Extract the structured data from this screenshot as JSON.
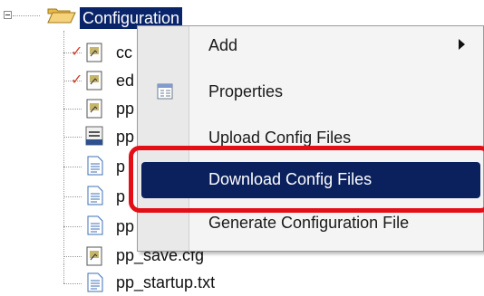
{
  "tree": {
    "root_folder": "Configuration",
    "children": [
      {
        "label": "cc"
      },
      {
        "label": "ed"
      },
      {
        "label": "pp"
      },
      {
        "label": "pp"
      },
      {
        "label": "p"
      },
      {
        "label": "p"
      },
      {
        "label": "pp"
      },
      {
        "label": "pp_save.cfg"
      },
      {
        "label": "pp_startup.txt"
      }
    ]
  },
  "context_menu": {
    "items": [
      {
        "label": "Add",
        "has_submenu": true
      },
      {
        "label": "Properties"
      },
      {
        "label": "Upload Config Files"
      },
      {
        "label": "Download Config Files",
        "highlighted": true
      },
      {
        "label": "Generate Configuration File"
      }
    ]
  },
  "colors": {
    "selection": "#0a246a",
    "menu_hover": "#0b215e",
    "annotation_outline": "#e30e16",
    "check_mark": "#d23b2b"
  }
}
